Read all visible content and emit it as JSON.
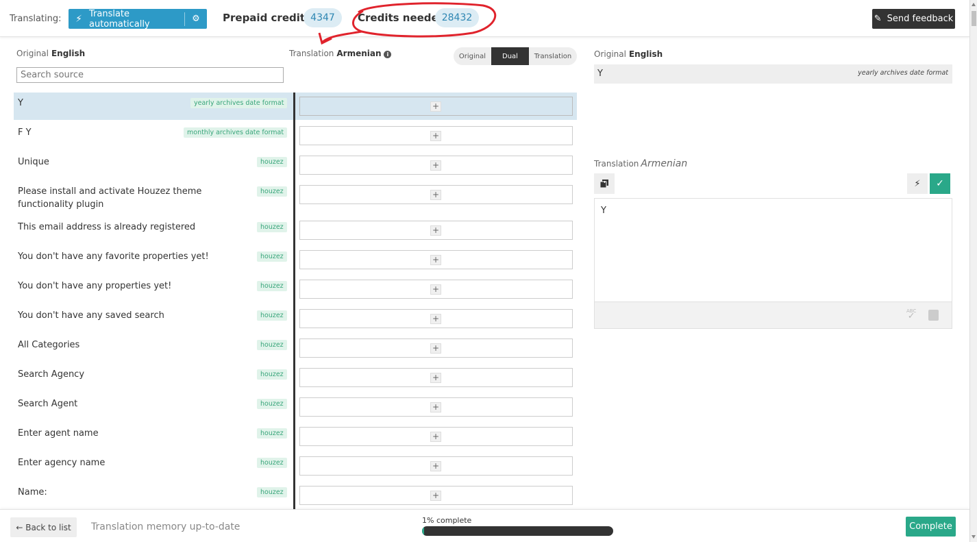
{
  "header": {
    "translating_label": "Translating:",
    "auto_button": "Translate automatically",
    "prepaid_label": "Prepaid credits:",
    "prepaid_value": "4347",
    "needed_label": "Credits needed",
    "needed_value": "28432",
    "feedback_button": "Send feedback"
  },
  "columns": {
    "original_label": "Original",
    "original_lang": "English",
    "translation_label": "Translation",
    "translation_lang": "Armenian",
    "search_placeholder": "Search source"
  },
  "view_modes": {
    "options": [
      "Original",
      "Dual",
      "Translation"
    ],
    "selected": "Dual"
  },
  "strings": [
    {
      "source": "Y",
      "tag": "yearly archives date format",
      "selected": true
    },
    {
      "source": "F Y",
      "tag": "monthly archives date format"
    },
    {
      "source": "Unique",
      "tag": "houzez"
    },
    {
      "source": "Please install and activate Houzez theme functionality plugin",
      "tag": "houzez"
    },
    {
      "source": "This email address is already registered",
      "tag": "houzez"
    },
    {
      "source": "You don't have any favorite properties yet!",
      "tag": "houzez"
    },
    {
      "source": "You don't have any properties yet!",
      "tag": "houzez"
    },
    {
      "source": "You don't have any saved search",
      "tag": "houzez"
    },
    {
      "source": "All Categories",
      "tag": "houzez"
    },
    {
      "source": "Search Agency",
      "tag": "houzez"
    },
    {
      "source": "Search Agent",
      "tag": "houzez"
    },
    {
      "source": "Enter agent name",
      "tag": "houzez"
    },
    {
      "source": "Enter agency name",
      "tag": "houzez"
    },
    {
      "source": "Name:",
      "tag": "houzez"
    }
  ],
  "detail": {
    "original_label": "Original",
    "original_lang": "English",
    "original_value": "Y",
    "original_note": "yearly archives date format",
    "translation_label": "Translation",
    "translation_lang": "Armenian",
    "editor_value": "Y"
  },
  "footer": {
    "back_button": "← Back to list",
    "tm_status": "Translation memory up-to-date",
    "progress_text": "1% complete",
    "progress_fraction": 0.01,
    "complete_button": "Complete"
  },
  "colors": {
    "accent_blue": "#2d9ac7",
    "accent_green": "#2aa889",
    "annotation_red": "#e0232c"
  },
  "icons": [
    "bolt-icon",
    "gear-icon",
    "pencil-icon",
    "info-icon",
    "plus-icon",
    "copy-icon",
    "check-icon",
    "spellcheck-icon",
    "keyboard-icon"
  ]
}
